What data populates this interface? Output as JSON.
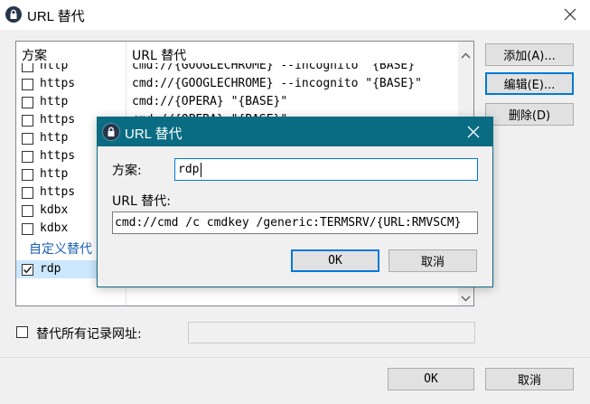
{
  "window": {
    "title": "URL 替代"
  },
  "list": {
    "col_scheme": "方案",
    "col_url": "URL 替代",
    "rows": [
      {
        "scheme": "http",
        "url": "cmd://{GOOGLECHROME} --incognito \"{BASE}\"",
        "checked": false
      },
      {
        "scheme": "https",
        "url": "cmd://{GOOGLECHROME} --incognito \"{BASE}\"",
        "checked": false
      },
      {
        "scheme": "http",
        "url": "cmd://{OPERA} \"{BASE}\"",
        "checked": false
      },
      {
        "scheme": "https",
        "url": "cmd://{OPERA} \"{BASE}\"",
        "checked": false
      },
      {
        "scheme": "http",
        "url": "",
        "checked": false
      },
      {
        "scheme": "https",
        "url": "",
        "checked": false
      },
      {
        "scheme": "http",
        "url": "",
        "checked": false
      },
      {
        "scheme": "https",
        "url": "",
        "checked": false
      },
      {
        "scheme": "kdbx",
        "url": "",
        "checked": false
      },
      {
        "scheme": "kdbx",
        "url": "",
        "checked": false
      }
    ],
    "group_label": "自定义替代",
    "custom_row": {
      "scheme": "rdp",
      "checked": true
    }
  },
  "side_buttons": {
    "add": "添加(A)...",
    "edit": "编辑(E)...",
    "delete": "删除(D)"
  },
  "override_all": {
    "label": "替代所有记录网址:",
    "value": ""
  },
  "footer": {
    "ok": "OK",
    "cancel": "取消"
  },
  "dialog": {
    "title": "URL 替代",
    "scheme_label": "方案:",
    "scheme_value": "rdp",
    "url_label": "URL 替代:",
    "url_value": "cmd://cmd /c cmdkey /generic:TERMSRV/{URL:RMVSCM}",
    "ok": "OK",
    "cancel": "取消"
  },
  "colors": {
    "dialog_title_bg": "#0a6c82",
    "selection_bg": "#cce8ff",
    "group_text": "#1a5fb4"
  }
}
